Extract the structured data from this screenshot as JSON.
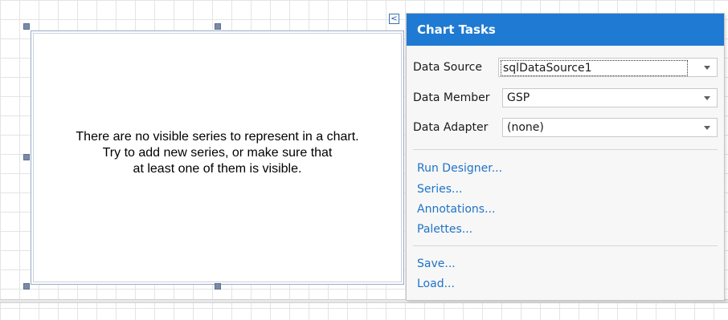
{
  "chart": {
    "message_line1": "There are no visible series to represent in a chart.",
    "message_line2": "Try to add new series, or make sure that",
    "message_line3": "at least one of them is visible."
  },
  "tasks_toggle": {
    "glyph": "<"
  },
  "tasks_panel": {
    "title": "Chart Tasks",
    "data_source": {
      "label": "Data Source",
      "value": "sqlDataSource1"
    },
    "data_member": {
      "label": "Data Member",
      "value": "GSP"
    },
    "data_adapter": {
      "label": "Data Adapter",
      "value": "(none)"
    },
    "actions": [
      "Run Designer...",
      "Series...",
      "Annotations...",
      "Palettes..."
    ],
    "file_actions": [
      "Save...",
      "Load..."
    ]
  },
  "colors": {
    "header": "#1e7ad2",
    "link": "#1e73c8",
    "handle": "#7a8ba8"
  }
}
